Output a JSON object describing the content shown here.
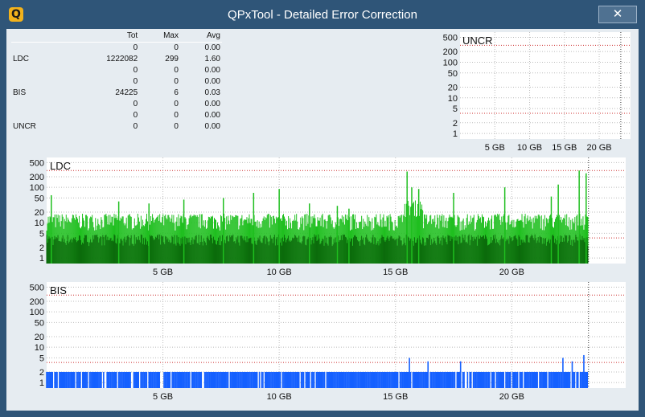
{
  "window": {
    "title": "QPxTool - Detailed Error Correction",
    "close_label": "✕",
    "icon_glyph": "Q"
  },
  "stats": {
    "headers": [
      "",
      "Tot",
      "Max",
      "Avg"
    ],
    "rows": [
      [
        "",
        "0",
        "0",
        "0.00"
      ],
      [
        "LDC",
        "1222082",
        "299",
        "1.60"
      ],
      [
        "",
        "0",
        "0",
        "0.00"
      ],
      [
        "",
        "0",
        "0",
        "0.00"
      ],
      [
        "BIS",
        "24225",
        "6",
        "0.03"
      ],
      [
        "",
        "0",
        "0",
        "0.00"
      ],
      [
        "",
        "0",
        "0",
        "0.00"
      ],
      [
        "UNCR",
        "0",
        "0",
        "0.00"
      ]
    ]
  },
  "chart_data": [
    {
      "type": "bar",
      "title": "UNCR",
      "scale": "log",
      "yticks": [
        500,
        200,
        100,
        50,
        20,
        10,
        5,
        2,
        1
      ],
      "xticks": [
        "5 GB",
        "10 GB",
        "15 GB",
        "20 GB"
      ],
      "threshold_color": "#cc2a2a",
      "values": []
    },
    {
      "type": "bar",
      "title": "LDC",
      "scale": "log",
      "yticks": [
        500,
        200,
        100,
        50,
        20,
        10,
        5,
        2,
        1
      ],
      "xticks": [
        "5 GB",
        "10 GB",
        "15 GB",
        "20 GB"
      ],
      "colors": {
        "light": "#1fbf1f",
        "dark": "#0b6b0b"
      },
      "max": 299,
      "spikes": [
        [
          0.2,
          60
        ],
        [
          3.1,
          40
        ],
        [
          4.4,
          35
        ],
        [
          5.9,
          45
        ],
        [
          7.6,
          50
        ],
        [
          8.9,
          70
        ],
        [
          10.0,
          90
        ],
        [
          11.3,
          35
        ],
        [
          12.5,
          30
        ],
        [
          13.0,
          25
        ],
        [
          15.5,
          280
        ],
        [
          15.7,
          100
        ],
        [
          16.0,
          90
        ],
        [
          17.5,
          70
        ],
        [
          19.7,
          100
        ],
        [
          21.7,
          55
        ],
        [
          22.0,
          120
        ],
        [
          22.9,
          299
        ],
        [
          23.2,
          250
        ]
      ]
    },
    {
      "type": "bar",
      "title": "BIS",
      "scale": "log",
      "yticks": [
        500,
        200,
        100,
        50,
        20,
        10,
        5,
        2,
        1
      ],
      "xticks": [
        "5 GB",
        "10 GB",
        "15 GB",
        "20 GB"
      ],
      "colors": {
        "fill": "#1560ff",
        "dark": "#0a2fbf"
      },
      "max": 6,
      "spikes": [
        [
          15.6,
          5
        ],
        [
          16.4,
          4
        ],
        [
          17.8,
          4
        ],
        [
          22.2,
          5
        ],
        [
          22.6,
          4
        ],
        [
          23.1,
          6
        ]
      ]
    }
  ]
}
